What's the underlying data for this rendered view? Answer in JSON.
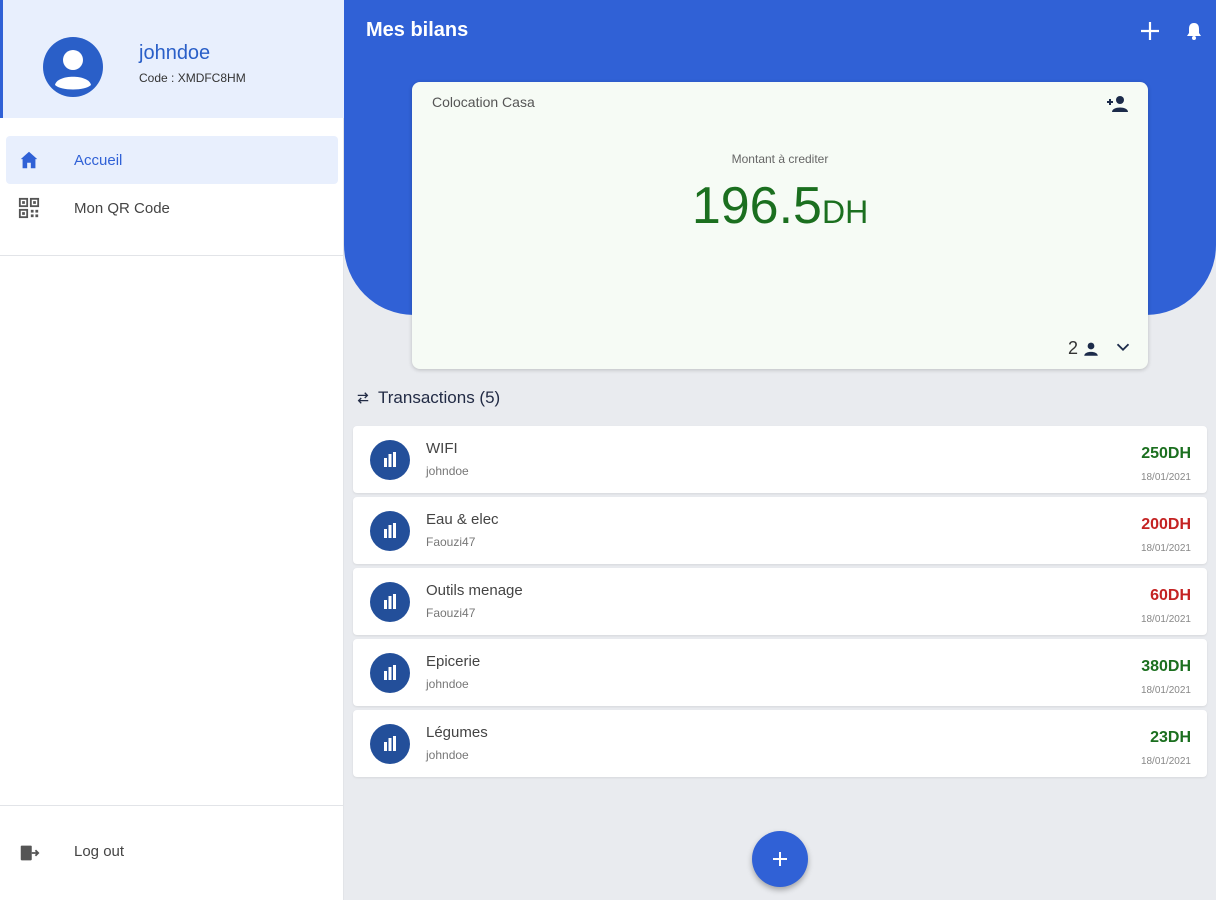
{
  "colors": {
    "primary": "#3061d6",
    "positive": "#1b6f1f",
    "negative": "#c42323"
  },
  "sidebar": {
    "profile": {
      "username": "johndoe",
      "code": "Code : XMDFC8HM"
    },
    "items": [
      {
        "label": "Accueil",
        "icon": "home-icon",
        "active": true
      },
      {
        "label": "Mon QR Code",
        "icon": "qr-code-icon",
        "active": false
      }
    ],
    "logout": {
      "label": "Log out",
      "icon": "logout-icon"
    }
  },
  "header": {
    "title": "Mes bilans"
  },
  "card": {
    "title": "Colocation Casa",
    "subtitle": "Montant à crediter",
    "amount": "196.5",
    "currency": "DH",
    "members": "2"
  },
  "transactions": {
    "title": "Transactions (5)",
    "items": [
      {
        "name": "WIFI",
        "user": "johndoe",
        "amount": "250DH",
        "date": "18/01/2021",
        "status": "positive"
      },
      {
        "name": "Eau & elec",
        "user": "Faouzi47",
        "amount": "200DH",
        "date": "18/01/2021",
        "status": "negative"
      },
      {
        "name": "Outils menage",
        "user": "Faouzi47",
        "amount": "60DH",
        "date": "18/01/2021",
        "status": "negative"
      },
      {
        "name": "Epicerie",
        "user": "johndoe",
        "amount": "380DH",
        "date": "18/01/2021",
        "status": "positive"
      },
      {
        "name": "Légumes",
        "user": "johndoe",
        "amount": "23DH",
        "date": "18/01/2021",
        "status": "positive"
      }
    ]
  }
}
